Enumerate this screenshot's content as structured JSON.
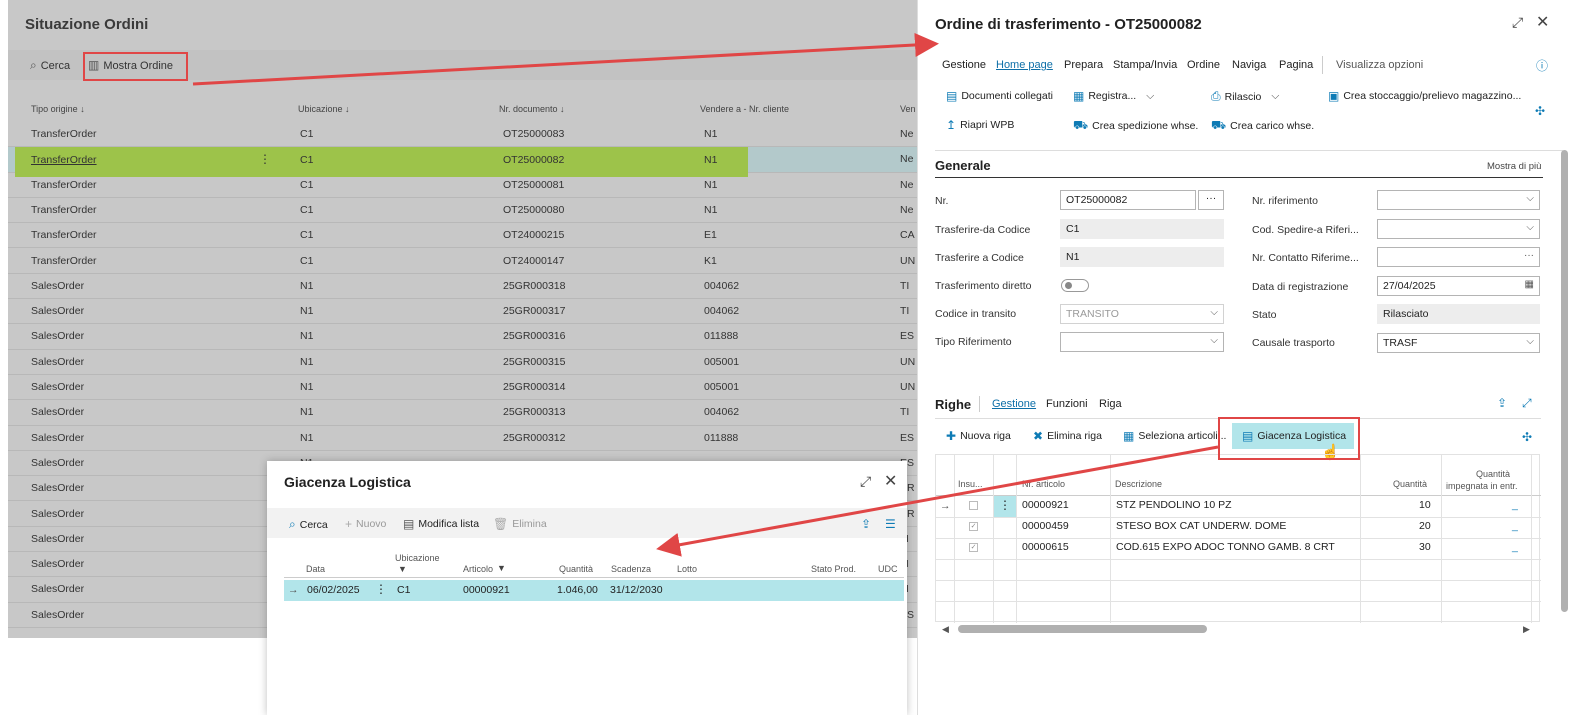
{
  "list_page": {
    "title": "Situazione Ordini",
    "search_label": "Cerca",
    "show_order_label": "Mostra Ordine",
    "columns": [
      "Tipo origine ↓",
      "Ubicazione ↓",
      "Nr. documento ↓",
      "Vendere a - Nr. cliente",
      "Ven"
    ],
    "rows": [
      [
        "TransferOrder",
        "C1",
        "OT25000083",
        "N1",
        "Ne"
      ],
      [
        "TransferOrder",
        "C1",
        "OT25000082",
        "N1",
        "Ne"
      ],
      [
        "TransferOrder",
        "C1",
        "OT25000081",
        "N1",
        "Ne"
      ],
      [
        "TransferOrder",
        "C1",
        "OT25000080",
        "N1",
        "Ne"
      ],
      [
        "TransferOrder",
        "C1",
        "OT24000215",
        "E1",
        "CA"
      ],
      [
        "TransferOrder",
        "C1",
        "OT24000147",
        "K1",
        "UN"
      ],
      [
        "SalesOrder",
        "N1",
        "25GR000318",
        "004062",
        "TI"
      ],
      [
        "SalesOrder",
        "N1",
        "25GR000317",
        "004062",
        "TI"
      ],
      [
        "SalesOrder",
        "N1",
        "25GR000316",
        "011888",
        "ES"
      ],
      [
        "SalesOrder",
        "N1",
        "25GR000315",
        "005001",
        "UN"
      ],
      [
        "SalesOrder",
        "N1",
        "25GR000314",
        "005001",
        "UN"
      ],
      [
        "SalesOrder",
        "N1",
        "25GR000313",
        "004062",
        "TI"
      ],
      [
        "SalesOrder",
        "N1",
        "25GR000312",
        "011888",
        "ES"
      ],
      [
        "SalesOrder",
        "N1",
        "",
        "",
        "ES"
      ],
      [
        "SalesOrder",
        "",
        "",
        "",
        "AR"
      ],
      [
        "SalesOrder",
        "",
        "",
        "",
        "AR"
      ],
      [
        "SalesOrder",
        "",
        "",
        "",
        "M"
      ],
      [
        "SalesOrder",
        "",
        "",
        "",
        "LI"
      ],
      [
        "SalesOrder",
        "",
        "",
        "",
        "M"
      ],
      [
        "SalesOrder",
        "",
        "",
        "",
        "AS"
      ]
    ]
  },
  "transfer": {
    "title": "Ordine di trasferimento - OT25000082",
    "menu": [
      "Gestione",
      "Home page",
      "Prepara",
      "Stampa/Invia",
      "Ordine",
      "Naviga",
      "Pagina",
      "Visualizza opzioni"
    ],
    "actions": {
      "linked_docs": "Documenti collegati",
      "register": "Registra...",
      "release": "Rilascio",
      "create_putaway": "Crea stoccaggio/prelievo magazzino...",
      "reopen": "Riapri WPB",
      "create_shipment": "Crea spedizione whse.",
      "create_receipt": "Crea carico whse."
    },
    "general_title": "Generale",
    "show_more": "Mostra di più",
    "fields_left": [
      {
        "label": "Nr.",
        "value": "OT25000082"
      },
      {
        "label": "Trasferire-da Codice",
        "value": "C1"
      },
      {
        "label": "Trasferire a Codice",
        "value": "N1"
      },
      {
        "label": "Trasferimento diretto",
        "value": ""
      },
      {
        "label": "Codice in transito",
        "value": "TRANSITO"
      },
      {
        "label": "Tipo Riferimento",
        "value": ""
      }
    ],
    "fields_right": [
      {
        "label": "Nr. riferimento",
        "value": ""
      },
      {
        "label": "Cod. Spedire-a Riferi...",
        "value": ""
      },
      {
        "label": "Nr. Contatto Riferime...",
        "value": ""
      },
      {
        "label": "Data di registrazione",
        "value": "27/04/2025"
      },
      {
        "label": "Stato",
        "value": "Rilasciato"
      },
      {
        "label": "Causale trasporto",
        "value": "TRASF"
      }
    ],
    "lines_title": "Righe",
    "lines_tabs": [
      "Gestione",
      "Funzioni",
      "Riga"
    ],
    "lines_actions": [
      "Nuova riga",
      "Elimina riga",
      "Seleziona articoli...",
      "Giacenza Logistica"
    ],
    "lines_headers": [
      "Insu...",
      "Nr. articolo",
      "Descrizione",
      "Quantità",
      "Quantità",
      "impegnata in entr."
    ],
    "lines": [
      {
        "item": "00000921",
        "desc": "STZ PENDOLINO 10 PZ",
        "qty": "10",
        "reserved": "_"
      },
      {
        "item": "00000459",
        "desc": "STESO BOX CAT UNDERW. DOME",
        "qty": "20",
        "reserved": "_"
      },
      {
        "item": "00000615",
        "desc": "COD.615 EXPO ADOC TONNO GAMB. 8 CRT",
        "qty": "30",
        "reserved": "_"
      }
    ]
  },
  "popup": {
    "title": "Giacenza Logistica",
    "actions": [
      "Cerca",
      "Nuovo",
      "Modifica lista",
      "Elimina"
    ],
    "headers": [
      "Data",
      "Ubicazione",
      "Articolo",
      "Quantità",
      "Scadenza",
      "Lotto",
      "Stato Prod.",
      "UDC"
    ],
    "row": {
      "date": "06/02/2025",
      "location": "C1",
      "item": "00000921",
      "qty": "1.046,00",
      "expiry": "31/12/2030",
      "lot": "",
      "state": "",
      "udc": ""
    }
  },
  "colors": {
    "accent": "#0e7bb5",
    "highlight_green": "#9dc34a",
    "arrow_red": "#e04646",
    "popup_row": "#b2e5ea"
  }
}
